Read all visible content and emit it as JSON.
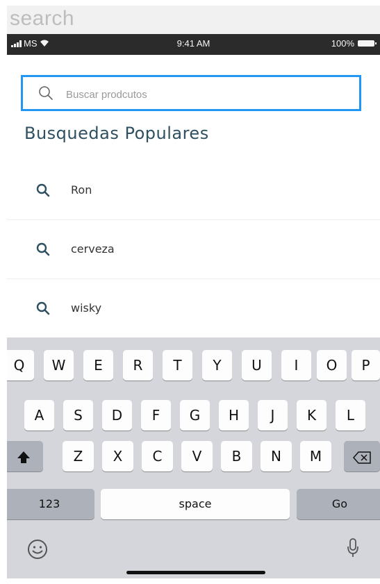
{
  "page_label": "search",
  "status_bar": {
    "carrier": "MS",
    "time": "9:41 AM",
    "battery": "100%"
  },
  "search": {
    "placeholder": "Buscar prodcutos",
    "value": ""
  },
  "section_title": "Busquedas Populares",
  "popular_searches": [
    {
      "label": "Ron"
    },
    {
      "label": "cerveza"
    },
    {
      "label": "wisky"
    }
  ],
  "keyboard": {
    "row1": [
      "Q",
      "W",
      "E",
      "R",
      "T",
      "Y",
      "U",
      "I",
      "O",
      "P"
    ],
    "row2": [
      "A",
      "S",
      "D",
      "F",
      "G",
      "H",
      "J",
      "K",
      "L"
    ],
    "row3": [
      "Z",
      "X",
      "C",
      "V",
      "B",
      "N",
      "M"
    ],
    "numbers_key": "123",
    "space_key": "space",
    "go_key": "Go"
  },
  "colors": {
    "accent": "#2196f3",
    "title": "#2e5060",
    "keyboard_bg": "#d4d6db"
  },
  "icons": [
    "signal-icon",
    "wifi-icon",
    "battery-icon",
    "search-icon",
    "shift-icon",
    "backspace-icon",
    "emoji-icon",
    "microphone-icon"
  ]
}
